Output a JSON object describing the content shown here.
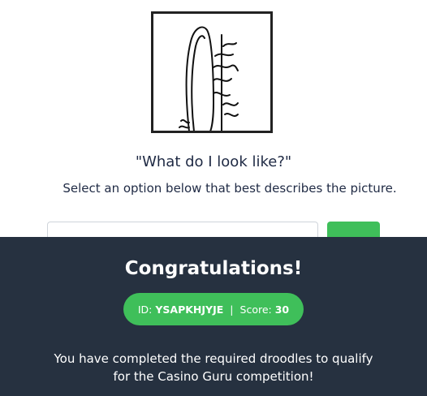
{
  "droodle": {
    "icon": "droodle-drawing"
  },
  "question": "\"What do I look like?\"",
  "instruction": "Select an option below that best describes the picture.",
  "answer": {
    "value": "",
    "submit_label": ""
  },
  "result": {
    "title": "Congratulations!",
    "id_label": "ID:",
    "id_value": "YSAPKHJYJE",
    "separator": "|",
    "score_label": "Score:",
    "score_value": "30",
    "message_line1": "You have completed the required droodles to qualify",
    "message_line2": "for the Casino Guru competition!"
  },
  "colors": {
    "overlay_bg": "#263140",
    "accent_green": "#3fbf5a",
    "text_dark": "#1f2a44"
  }
}
